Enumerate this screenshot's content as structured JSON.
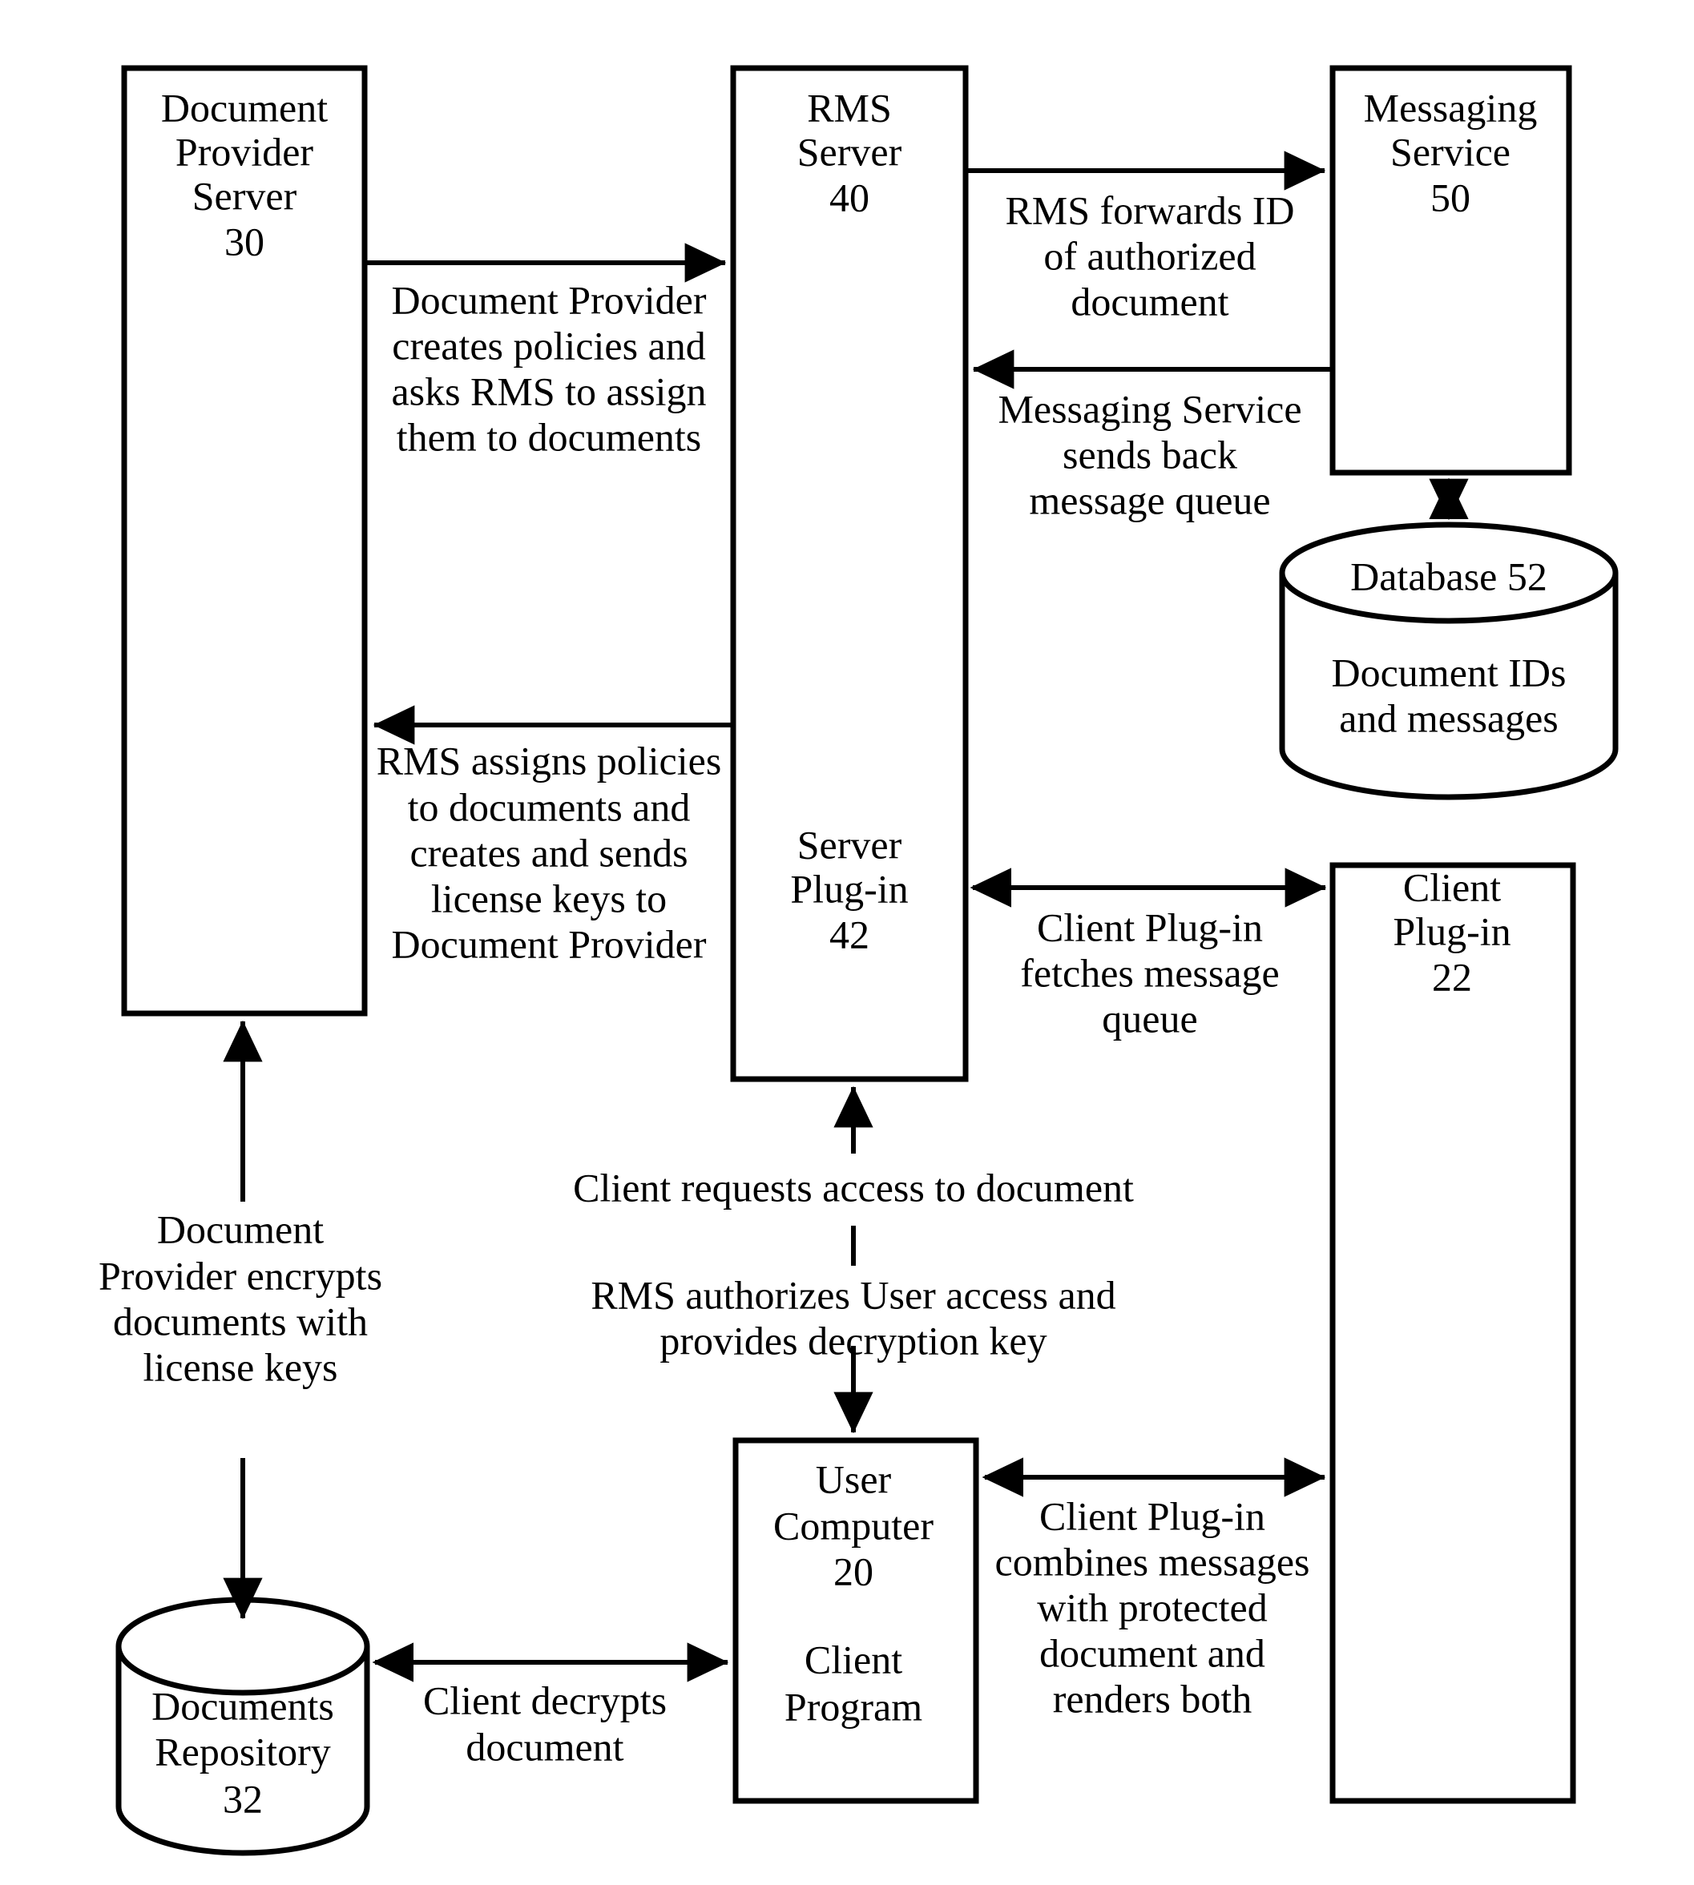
{
  "figure": {
    "type": "system-architecture-block-diagram",
    "background_color": "#ffffff",
    "line_color": "#000000"
  },
  "nodes": {
    "document_provider_server": {
      "name": "Document Provider Server",
      "lines": [
        "Document",
        "Provider",
        "Server",
        "30"
      ],
      "ref": "30",
      "shape": "rectangle"
    },
    "rms_server": {
      "name": "RMS Server",
      "lines": [
        "RMS",
        "Server",
        "40"
      ],
      "ref": "40",
      "shape": "rectangle"
    },
    "server_plugin": {
      "name": "Server Plug-in",
      "lines": [
        "Server",
        "Plug-in",
        "42"
      ],
      "ref": "42",
      "shape": "rectangle"
    },
    "messaging_service": {
      "name": "Messaging Service",
      "lines": [
        "Messaging",
        "Service",
        "50"
      ],
      "ref": "50",
      "shape": "rectangle"
    },
    "database": {
      "name": "Database 52",
      "title": "Database 52",
      "lines": [
        "Document IDs",
        "and messages"
      ],
      "ref": "52",
      "shape": "cylinder"
    },
    "client_plugin": {
      "name": "Client Plug-in",
      "lines": [
        "Client",
        "Plug-in",
        "22"
      ],
      "ref": "22",
      "shape": "rectangle"
    },
    "user_computer": {
      "name": "User Computer",
      "lines": [
        "User",
        "Computer",
        "20"
      ],
      "lines_secondary": [
        "Client",
        "Program"
      ],
      "ref": "20",
      "shape": "rectangle"
    },
    "documents_repository": {
      "name": "Documents Repository",
      "lines": [
        "Documents",
        "Repository",
        "32"
      ],
      "ref": "32",
      "shape": "cylinder"
    }
  },
  "edges": {
    "provider_to_rms": {
      "from": "document_provider_server",
      "to": "rms_server",
      "direction": "forward",
      "lines": [
        "Document Provider",
        "creates policies and",
        "asks RMS to assign",
        "them to documents"
      ]
    },
    "rms_to_provider": {
      "from": "rms_server",
      "to": "document_provider_server",
      "direction": "forward",
      "lines": [
        "RMS assigns policies",
        "to documents and",
        "creates and sends",
        "license keys to",
        "Document Provider"
      ]
    },
    "rms_to_messaging": {
      "from": "rms_server",
      "to": "messaging_service",
      "direction": "forward",
      "lines": [
        "RMS forwards ID",
        "of authorized",
        "document"
      ]
    },
    "messaging_to_rms": {
      "from": "messaging_service",
      "to": "rms_server",
      "direction": "forward",
      "lines": [
        "Messaging Service",
        "sends back",
        "message queue"
      ]
    },
    "messaging_to_database": {
      "from": "messaging_service",
      "to": "database",
      "direction": "bidirectional",
      "lines": []
    },
    "clientplugin_to_serverplugin": {
      "from": "client_plugin",
      "to": "server_plugin",
      "direction": "bidirectional",
      "lines": [
        "Client Plug-in",
        "fetches message",
        "queue"
      ]
    },
    "client_requests_access": {
      "from": "user_computer",
      "to": "server_plugin",
      "direction": "forward",
      "lines": [
        "Client requests access to document"
      ]
    },
    "rms_authorizes": {
      "from": "server_plugin",
      "to": "user_computer",
      "direction": "forward",
      "lines": [
        "RMS authorizes User access and",
        "provides decryption key"
      ]
    },
    "clientplugin_to_usercomputer": {
      "from": "client_plugin",
      "to": "user_computer",
      "direction": "bidirectional",
      "lines": [
        "Client Plug-in",
        "combines messages",
        "with protected",
        "document and",
        "renders both"
      ]
    },
    "provider_encrypts": {
      "from": "documents_repository",
      "to": "document_provider_server",
      "direction": "forward",
      "lines": [
        "Document",
        "Provider encrypts",
        "documents with",
        "license keys"
      ]
    },
    "repository_to_usercomputer": {
      "from": "documents_repository",
      "to": "user_computer",
      "direction": "bidirectional",
      "lines": [
        "Client decrypts",
        "document"
      ]
    }
  }
}
